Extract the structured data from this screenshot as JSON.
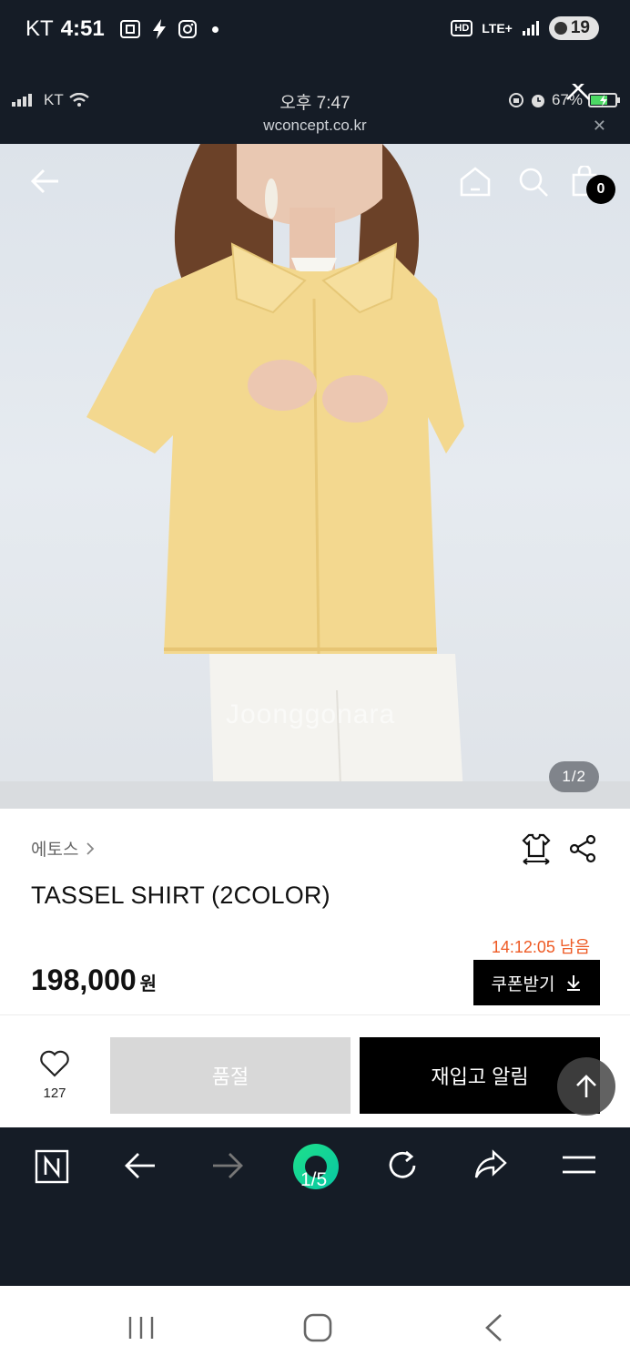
{
  "outer_status": {
    "carrier": "KT",
    "time": "4:51",
    "hd": "HD",
    "network": "LTE+",
    "battery": "19"
  },
  "inner_status": {
    "carrier": "KT",
    "time": "오후 7:47",
    "url": "wconcept.co.kr",
    "battery": "67%"
  },
  "product": {
    "watermark": "Joonggonara",
    "image_page": "1/2",
    "cart_count": "0",
    "brand": "에토스",
    "name": "TASSEL SHIRT (2COLOR)",
    "timer": "14:12:05 남음",
    "price": "198,000",
    "currency": "원",
    "coupon_label": "쿠폰받기",
    "like_count": "127",
    "soldout_label": "품절",
    "restock_label": "재입고 알림"
  },
  "browser": {
    "tab_count": "1/5"
  },
  "colors": {
    "accent_timer": "#ee5a24",
    "dark_bar": "#151c26",
    "shirt": "#f3d88f"
  }
}
